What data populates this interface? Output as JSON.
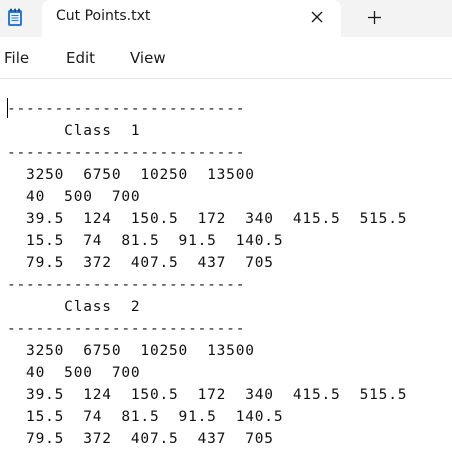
{
  "window": {
    "tab_title": "Cut Points.txt",
    "app_icon": "notepad-icon",
    "close_icon": "close-icon",
    "new_tab_icon": "plus-icon"
  },
  "menu": {
    "file": "File",
    "edit": "Edit",
    "view": "View"
  },
  "document": {
    "lines": [
      "-------------------------",
      "      Class  1",
      "-------------------------",
      "  3250  6750  10250  13500",
      "  40  500  700",
      "  39.5  124  150.5  172  340  415.5  515.5",
      "  15.5  74  81.5  91.5  140.5",
      "  79.5  372  407.5  437  705",
      "-------------------------",
      "      Class  2",
      "-------------------------",
      "  3250  6750  10250  13500",
      "  40  500  700",
      "  39.5  124  150.5  172  340  415.5  515.5",
      "  15.5  74  81.5  91.5  140.5",
      "  79.5  372  407.5  437  705"
    ]
  },
  "colors": {
    "titlebar": "#f3f3f3",
    "text": "#111111",
    "icon_blue": "#1f6fc5"
  }
}
